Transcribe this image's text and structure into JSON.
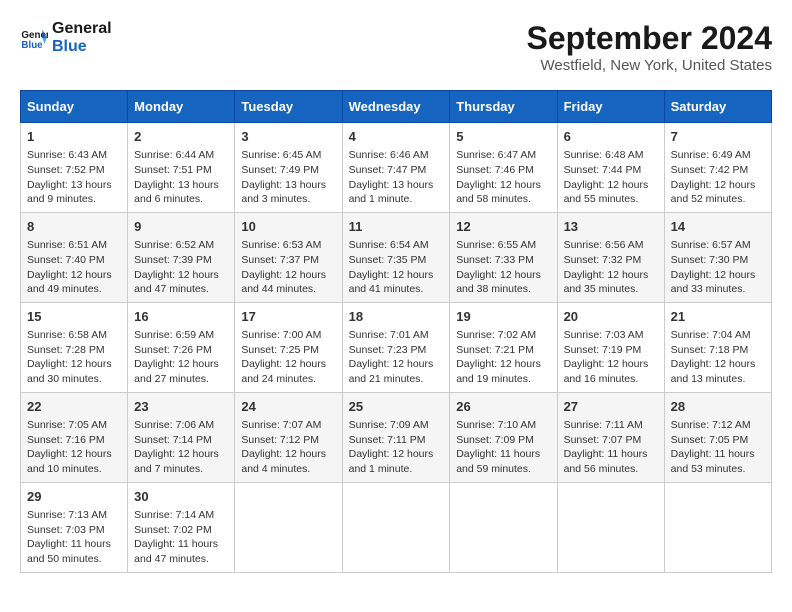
{
  "logo": {
    "line1": "General",
    "line2": "Blue"
  },
  "title": "September 2024",
  "subtitle": "Westfield, New York, United States",
  "headers": [
    "Sunday",
    "Monday",
    "Tuesday",
    "Wednesday",
    "Thursday",
    "Friday",
    "Saturday"
  ],
  "weeks": [
    [
      {
        "day": "1",
        "info": "Sunrise: 6:43 AM\nSunset: 7:52 PM\nDaylight: 13 hours\nand 9 minutes."
      },
      {
        "day": "2",
        "info": "Sunrise: 6:44 AM\nSunset: 7:51 PM\nDaylight: 13 hours\nand 6 minutes."
      },
      {
        "day": "3",
        "info": "Sunrise: 6:45 AM\nSunset: 7:49 PM\nDaylight: 13 hours\nand 3 minutes."
      },
      {
        "day": "4",
        "info": "Sunrise: 6:46 AM\nSunset: 7:47 PM\nDaylight: 13 hours\nand 1 minute."
      },
      {
        "day": "5",
        "info": "Sunrise: 6:47 AM\nSunset: 7:46 PM\nDaylight: 12 hours\nand 58 minutes."
      },
      {
        "day": "6",
        "info": "Sunrise: 6:48 AM\nSunset: 7:44 PM\nDaylight: 12 hours\nand 55 minutes."
      },
      {
        "day": "7",
        "info": "Sunrise: 6:49 AM\nSunset: 7:42 PM\nDaylight: 12 hours\nand 52 minutes."
      }
    ],
    [
      {
        "day": "8",
        "info": "Sunrise: 6:51 AM\nSunset: 7:40 PM\nDaylight: 12 hours\nand 49 minutes."
      },
      {
        "day": "9",
        "info": "Sunrise: 6:52 AM\nSunset: 7:39 PM\nDaylight: 12 hours\nand 47 minutes."
      },
      {
        "day": "10",
        "info": "Sunrise: 6:53 AM\nSunset: 7:37 PM\nDaylight: 12 hours\nand 44 minutes."
      },
      {
        "day": "11",
        "info": "Sunrise: 6:54 AM\nSunset: 7:35 PM\nDaylight: 12 hours\nand 41 minutes."
      },
      {
        "day": "12",
        "info": "Sunrise: 6:55 AM\nSunset: 7:33 PM\nDaylight: 12 hours\nand 38 minutes."
      },
      {
        "day": "13",
        "info": "Sunrise: 6:56 AM\nSunset: 7:32 PM\nDaylight: 12 hours\nand 35 minutes."
      },
      {
        "day": "14",
        "info": "Sunrise: 6:57 AM\nSunset: 7:30 PM\nDaylight: 12 hours\nand 33 minutes."
      }
    ],
    [
      {
        "day": "15",
        "info": "Sunrise: 6:58 AM\nSunset: 7:28 PM\nDaylight: 12 hours\nand 30 minutes."
      },
      {
        "day": "16",
        "info": "Sunrise: 6:59 AM\nSunset: 7:26 PM\nDaylight: 12 hours\nand 27 minutes."
      },
      {
        "day": "17",
        "info": "Sunrise: 7:00 AM\nSunset: 7:25 PM\nDaylight: 12 hours\nand 24 minutes."
      },
      {
        "day": "18",
        "info": "Sunrise: 7:01 AM\nSunset: 7:23 PM\nDaylight: 12 hours\nand 21 minutes."
      },
      {
        "day": "19",
        "info": "Sunrise: 7:02 AM\nSunset: 7:21 PM\nDaylight: 12 hours\nand 19 minutes."
      },
      {
        "day": "20",
        "info": "Sunrise: 7:03 AM\nSunset: 7:19 PM\nDaylight: 12 hours\nand 16 minutes."
      },
      {
        "day": "21",
        "info": "Sunrise: 7:04 AM\nSunset: 7:18 PM\nDaylight: 12 hours\nand 13 minutes."
      }
    ],
    [
      {
        "day": "22",
        "info": "Sunrise: 7:05 AM\nSunset: 7:16 PM\nDaylight: 12 hours\nand 10 minutes."
      },
      {
        "day": "23",
        "info": "Sunrise: 7:06 AM\nSunset: 7:14 PM\nDaylight: 12 hours\nand 7 minutes."
      },
      {
        "day": "24",
        "info": "Sunrise: 7:07 AM\nSunset: 7:12 PM\nDaylight: 12 hours\nand 4 minutes."
      },
      {
        "day": "25",
        "info": "Sunrise: 7:09 AM\nSunset: 7:11 PM\nDaylight: 12 hours\nand 1 minute."
      },
      {
        "day": "26",
        "info": "Sunrise: 7:10 AM\nSunset: 7:09 PM\nDaylight: 11 hours\nand 59 minutes."
      },
      {
        "day": "27",
        "info": "Sunrise: 7:11 AM\nSunset: 7:07 PM\nDaylight: 11 hours\nand 56 minutes."
      },
      {
        "day": "28",
        "info": "Sunrise: 7:12 AM\nSunset: 7:05 PM\nDaylight: 11 hours\nand 53 minutes."
      }
    ],
    [
      {
        "day": "29",
        "info": "Sunrise: 7:13 AM\nSunset: 7:03 PM\nDaylight: 11 hours\nand 50 minutes."
      },
      {
        "day": "30",
        "info": "Sunrise: 7:14 AM\nSunset: 7:02 PM\nDaylight: 11 hours\nand 47 minutes."
      },
      null,
      null,
      null,
      null,
      null
    ]
  ]
}
